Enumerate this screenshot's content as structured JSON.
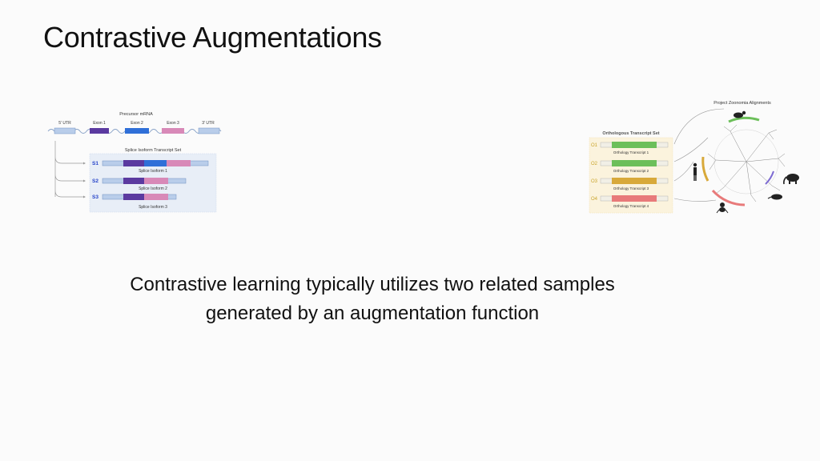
{
  "slide": {
    "title": "Contrastive Augmentations",
    "caption_line1": "Contrastive learning typically utilizes two related samples",
    "caption_line2": "generated by an augmentation function"
  },
  "splice_diagram": {
    "precursor_label": "Precursor mRNA",
    "utr5": "5' UTR",
    "exon1": "Exon 1",
    "exon2": "Exon 2",
    "exon3": "Exon 3",
    "utr3": "3' UTR",
    "set_title": "Splice Isoform Transcript Set",
    "isoforms": [
      {
        "id": "S1",
        "label": "Splice Isoform 1"
      },
      {
        "id": "S2",
        "label": "Splice Isoform 2"
      },
      {
        "id": "S3",
        "label": "Splice Isoform 3"
      }
    ],
    "colors": {
      "exon1": "#5b3aa0",
      "exon2": "#2f6fd8",
      "exon3": "#d889b8",
      "utr": "#b9cdea",
      "id": "#2442c9"
    }
  },
  "ortholog_diagram": {
    "alignments_label": "Project Zoonomia Alignments",
    "set_title": "Orthologous Transcript Set",
    "transcripts": [
      {
        "id": "O1",
        "label": "Orthology Transcript 1",
        "color": "#6cbf5a"
      },
      {
        "id": "O2",
        "label": "Orthology Transcript 2",
        "color": "#6cbf5a"
      },
      {
        "id": "O3",
        "label": "Orthology Transcript 3",
        "color": "#d8a93a"
      },
      {
        "id": "O4",
        "label": "Orthology Transcript 4",
        "color": "#e87a7a"
      }
    ]
  }
}
